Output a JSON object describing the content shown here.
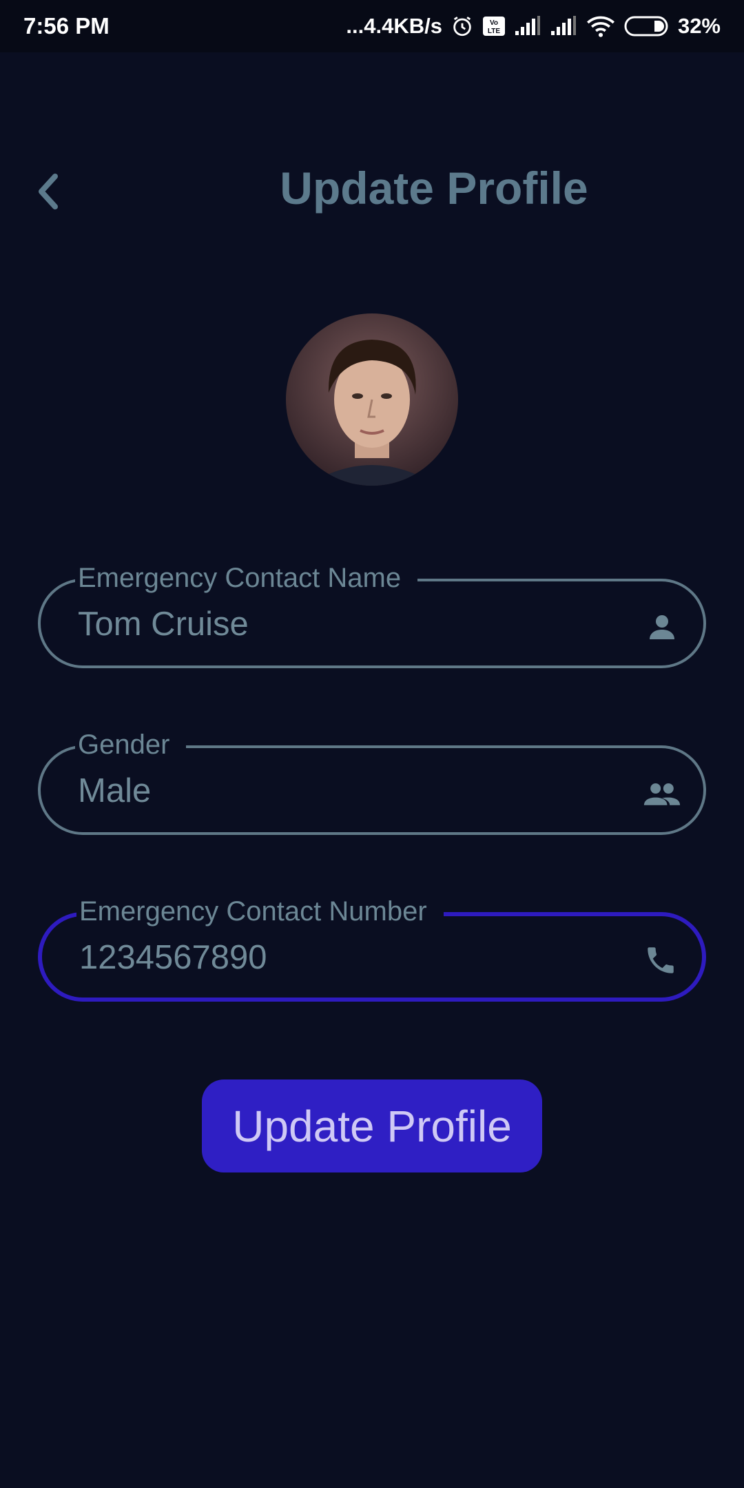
{
  "status_bar": {
    "time": "7:56 PM",
    "network_speed": "...4.4KB/s",
    "battery": "32%",
    "icons": [
      "alarm-icon",
      "volte-icon",
      "signal-icon",
      "signal-icon",
      "wifi-icon",
      "battery-icon"
    ]
  },
  "header": {
    "back_icon": "chevron-left-icon",
    "title": "Update Profile"
  },
  "avatar": {
    "alt": "profile-photo"
  },
  "form": {
    "emergency_name": {
      "label": "Emergency Contact Name",
      "value": "Tom Cruise",
      "icon": "person-icon"
    },
    "gender": {
      "label": "Gender",
      "value": "Male",
      "icon": "people-icon"
    },
    "emergency_number": {
      "label": "Emergency Contact Number",
      "value": "1234567890",
      "icon": "phone-icon"
    }
  },
  "submit": {
    "label": "Update Profile"
  },
  "colors": {
    "background": "#0a0e21",
    "accent": "#2f1fc4",
    "muted": "#5f7887"
  }
}
